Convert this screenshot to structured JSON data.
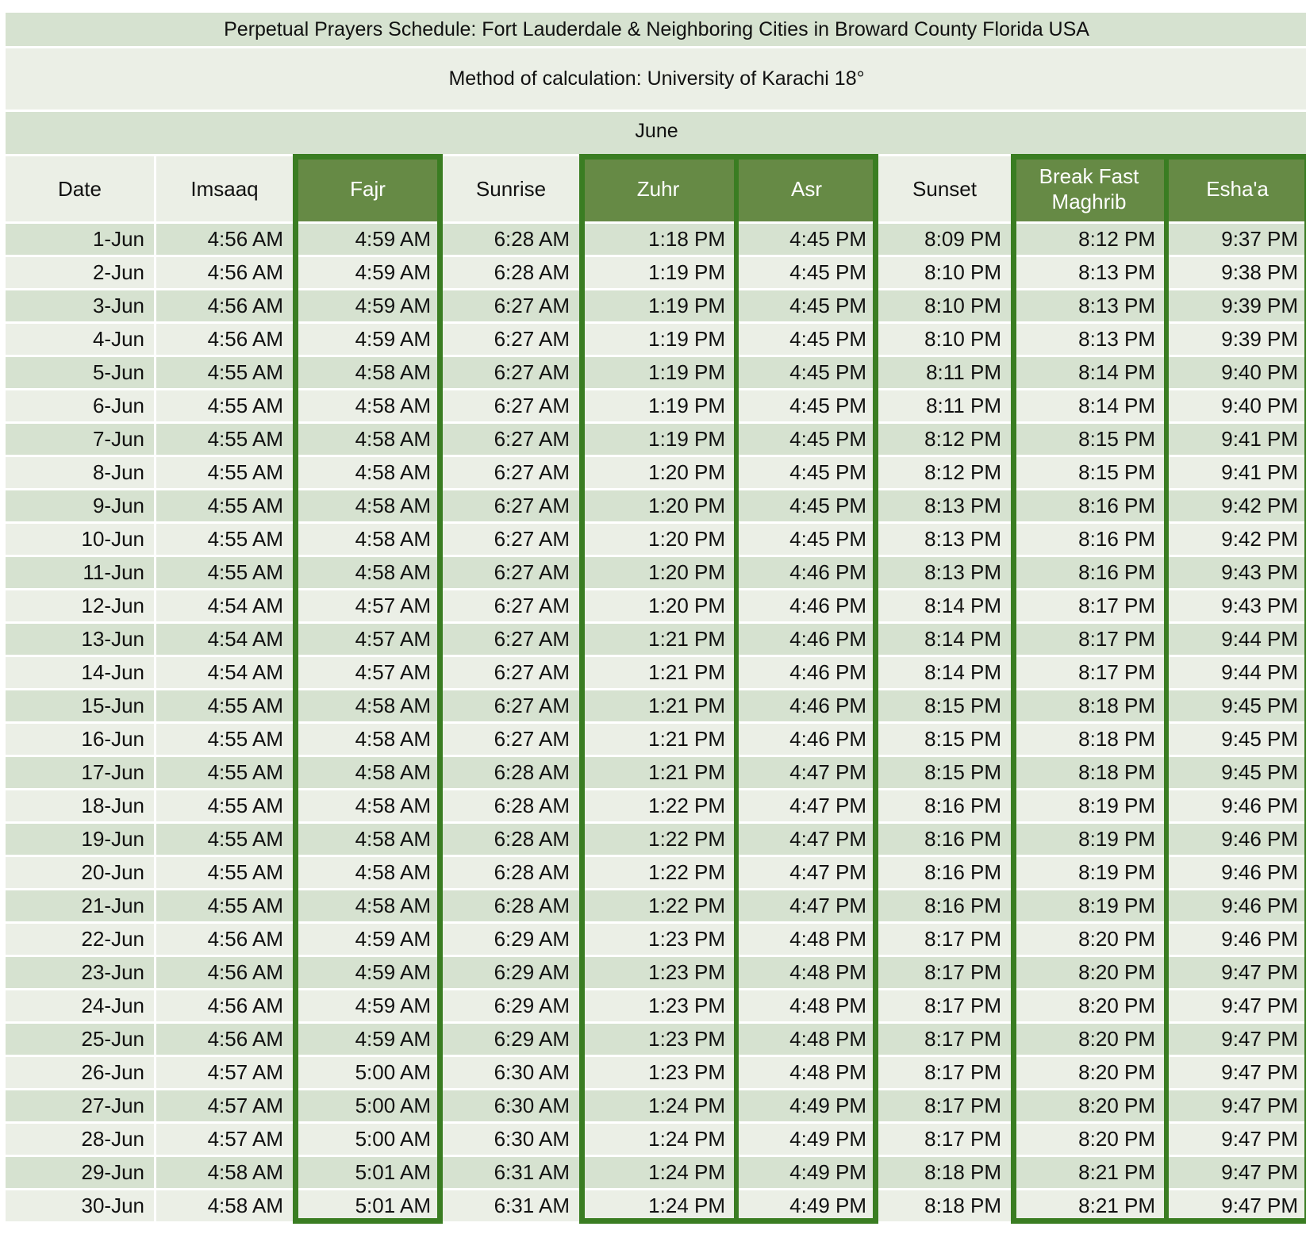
{
  "title": "Perpetual Prayers Schedule: Fort Lauderdale & Neighboring Cities in Broward County Florida  USA",
  "method": "Method of calculation: University of Karachi 18°",
  "month": "June",
  "colors": {
    "band_dark": "#d6e2d0",
    "band_light": "#ebefe6",
    "header_highlight": "#668a45",
    "border_green": "#3a7d22"
  },
  "columns": [
    "Date",
    "Imsaaq",
    "Fajr",
    "Sunrise",
    "Zuhr",
    "Asr",
    "Sunset",
    "Break Fast Maghrib",
    "Esha'a"
  ],
  "rows": [
    [
      "1-Jun",
      "4:56 AM",
      "4:59 AM",
      "6:28 AM",
      "1:18 PM",
      "4:45 PM",
      "8:09 PM",
      "8:12 PM",
      "9:37 PM"
    ],
    [
      "2-Jun",
      "4:56 AM",
      "4:59 AM",
      "6:28 AM",
      "1:19 PM",
      "4:45 PM",
      "8:10 PM",
      "8:13 PM",
      "9:38 PM"
    ],
    [
      "3-Jun",
      "4:56 AM",
      "4:59 AM",
      "6:27 AM",
      "1:19 PM",
      "4:45 PM",
      "8:10 PM",
      "8:13 PM",
      "9:39 PM"
    ],
    [
      "4-Jun",
      "4:56 AM",
      "4:59 AM",
      "6:27 AM",
      "1:19 PM",
      "4:45 PM",
      "8:10 PM",
      "8:13 PM",
      "9:39 PM"
    ],
    [
      "5-Jun",
      "4:55 AM",
      "4:58 AM",
      "6:27 AM",
      "1:19 PM",
      "4:45 PM",
      "8:11 PM",
      "8:14 PM",
      "9:40 PM"
    ],
    [
      "6-Jun",
      "4:55 AM",
      "4:58 AM",
      "6:27 AM",
      "1:19 PM",
      "4:45 PM",
      "8:11 PM",
      "8:14 PM",
      "9:40 PM"
    ],
    [
      "7-Jun",
      "4:55 AM",
      "4:58 AM",
      "6:27 AM",
      "1:19 PM",
      "4:45 PM",
      "8:12 PM",
      "8:15 PM",
      "9:41 PM"
    ],
    [
      "8-Jun",
      "4:55 AM",
      "4:58 AM",
      "6:27 AM",
      "1:20 PM",
      "4:45 PM",
      "8:12 PM",
      "8:15 PM",
      "9:41 PM"
    ],
    [
      "9-Jun",
      "4:55 AM",
      "4:58 AM",
      "6:27 AM",
      "1:20 PM",
      "4:45 PM",
      "8:13 PM",
      "8:16 PM",
      "9:42 PM"
    ],
    [
      "10-Jun",
      "4:55 AM",
      "4:58 AM",
      "6:27 AM",
      "1:20 PM",
      "4:45 PM",
      "8:13 PM",
      "8:16 PM",
      "9:42 PM"
    ],
    [
      "11-Jun",
      "4:55 AM",
      "4:58 AM",
      "6:27 AM",
      "1:20 PM",
      "4:46 PM",
      "8:13 PM",
      "8:16 PM",
      "9:43 PM"
    ],
    [
      "12-Jun",
      "4:54 AM",
      "4:57 AM",
      "6:27 AM",
      "1:20 PM",
      "4:46 PM",
      "8:14 PM",
      "8:17 PM",
      "9:43 PM"
    ],
    [
      "13-Jun",
      "4:54 AM",
      "4:57 AM",
      "6:27 AM",
      "1:21 PM",
      "4:46 PM",
      "8:14 PM",
      "8:17 PM",
      "9:44 PM"
    ],
    [
      "14-Jun",
      "4:54 AM",
      "4:57 AM",
      "6:27 AM",
      "1:21 PM",
      "4:46 PM",
      "8:14 PM",
      "8:17 PM",
      "9:44 PM"
    ],
    [
      "15-Jun",
      "4:55 AM",
      "4:58 AM",
      "6:27 AM",
      "1:21 PM",
      "4:46 PM",
      "8:15 PM",
      "8:18 PM",
      "9:45 PM"
    ],
    [
      "16-Jun",
      "4:55 AM",
      "4:58 AM",
      "6:27 AM",
      "1:21 PM",
      "4:46 PM",
      "8:15 PM",
      "8:18 PM",
      "9:45 PM"
    ],
    [
      "17-Jun",
      "4:55 AM",
      "4:58 AM",
      "6:28 AM",
      "1:21 PM",
      "4:47 PM",
      "8:15 PM",
      "8:18 PM",
      "9:45 PM"
    ],
    [
      "18-Jun",
      "4:55 AM",
      "4:58 AM",
      "6:28 AM",
      "1:22 PM",
      "4:47 PM",
      "8:16 PM",
      "8:19 PM",
      "9:46 PM"
    ],
    [
      "19-Jun",
      "4:55 AM",
      "4:58 AM",
      "6:28 AM",
      "1:22 PM",
      "4:47 PM",
      "8:16 PM",
      "8:19 PM",
      "9:46 PM"
    ],
    [
      "20-Jun",
      "4:55 AM",
      "4:58 AM",
      "6:28 AM",
      "1:22 PM",
      "4:47 PM",
      "8:16 PM",
      "8:19 PM",
      "9:46 PM"
    ],
    [
      "21-Jun",
      "4:55 AM",
      "4:58 AM",
      "6:28 AM",
      "1:22 PM",
      "4:47 PM",
      "8:16 PM",
      "8:19 PM",
      "9:46 PM"
    ],
    [
      "22-Jun",
      "4:56 AM",
      "4:59 AM",
      "6:29 AM",
      "1:23 PM",
      "4:48 PM",
      "8:17 PM",
      "8:20 PM",
      "9:46 PM"
    ],
    [
      "23-Jun",
      "4:56 AM",
      "4:59 AM",
      "6:29 AM",
      "1:23 PM",
      "4:48 PM",
      "8:17 PM",
      "8:20 PM",
      "9:47 PM"
    ],
    [
      "24-Jun",
      "4:56 AM",
      "4:59 AM",
      "6:29 AM",
      "1:23 PM",
      "4:48 PM",
      "8:17 PM",
      "8:20 PM",
      "9:47 PM"
    ],
    [
      "25-Jun",
      "4:56 AM",
      "4:59 AM",
      "6:29 AM",
      "1:23 PM",
      "4:48 PM",
      "8:17 PM",
      "8:20 PM",
      "9:47 PM"
    ],
    [
      "26-Jun",
      "4:57 AM",
      "5:00 AM",
      "6:30 AM",
      "1:23 PM",
      "4:48 PM",
      "8:17 PM",
      "8:20 PM",
      "9:47 PM"
    ],
    [
      "27-Jun",
      "4:57 AM",
      "5:00 AM",
      "6:30 AM",
      "1:24 PM",
      "4:49 PM",
      "8:17 PM",
      "8:20 PM",
      "9:47 PM"
    ],
    [
      "28-Jun",
      "4:57 AM",
      "5:00 AM",
      "6:30 AM",
      "1:24 PM",
      "4:49 PM",
      "8:17 PM",
      "8:20 PM",
      "9:47 PM"
    ],
    [
      "29-Jun",
      "4:58 AM",
      "5:01 AM",
      "6:31 AM",
      "1:24 PM",
      "4:49 PM",
      "8:18 PM",
      "8:21 PM",
      "9:47 PM"
    ],
    [
      "30-Jun",
      "4:58 AM",
      "5:01 AM",
      "6:31 AM",
      "1:24 PM",
      "4:49 PM",
      "8:18 PM",
      "8:21 PM",
      "9:47 PM"
    ]
  ]
}
